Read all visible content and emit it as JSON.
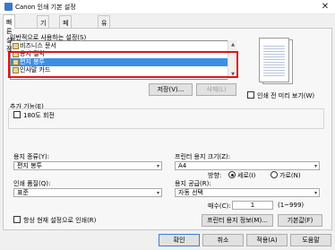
{
  "window": {
    "title": "Canon 인쇄 기본 설정",
    "close_glyph": "✕"
  },
  "tabs": [
    {
      "label": "빠른 설정"
    },
    {
      "label": "기본"
    },
    {
      "label": "페이지 설정"
    },
    {
      "label": "유지 관리"
    }
  ],
  "profiles": {
    "label": "일반적으로 사용하는 설정(S)",
    "items": [
      "비즈니스 문서",
      "용지 절약",
      "편지 봉투",
      "인사말 카드"
    ],
    "selected_index": 2,
    "save_button": "저장(V)...",
    "delete_button": "삭제(L)"
  },
  "preview": {
    "checkbox_label": "인쇄 전 미리 보기(W)"
  },
  "extra": {
    "label": "추가 기능(E)",
    "rotate_label": "180도 회전"
  },
  "media": {
    "label": "용지 종류(Y):",
    "value": "편지 봉투"
  },
  "paper_size": {
    "label": "프린터 용지 크기(Z):",
    "value": "A4",
    "orientation_label": "방향:",
    "portrait": "세로(I)",
    "landscape": "가로(N)",
    "orientation_selected": "portrait"
  },
  "quality": {
    "label": "인쇄 품질(Q):",
    "value": "표준"
  },
  "paper_source": {
    "label": "용지 공급(R):",
    "value": "자동 선택"
  },
  "copies": {
    "label": "매수(C):",
    "value": "1",
    "range": "(1~999)"
  },
  "always_print": {
    "label": "항상 현재 설정으로 인쇄(R)"
  },
  "buttons": {
    "printer_info": "프린터 용지 정보(M)...",
    "defaults": "기본값(F)",
    "ok": "확인",
    "cancel": "취소",
    "apply": "적용(A)",
    "help": "도움말"
  },
  "icons": {
    "chevron": "chevron-down-icon",
    "scroll_up": "▲",
    "scroll_down": "▼",
    "dropdown": "▾"
  },
  "colors": {
    "selection": "#3c8ee6",
    "highlight_border": "#e0131a"
  }
}
